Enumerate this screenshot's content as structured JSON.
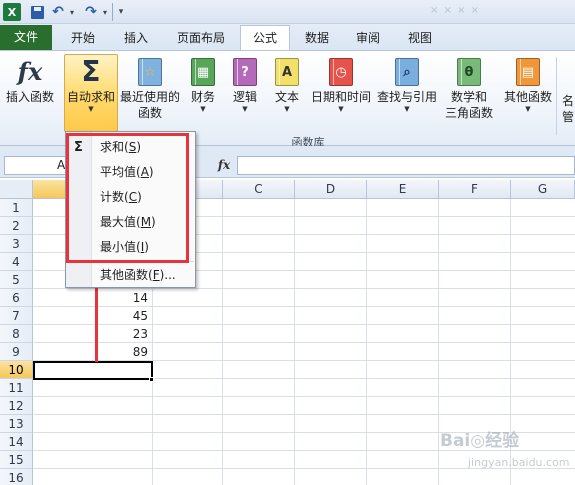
{
  "quick_access": {
    "app_logo": "X",
    "undo_icon": "↶",
    "redo_icon": "↷",
    "dropdown_glyph": "▾",
    "customize_glyph": "▾",
    "title_faint": "× × × ×"
  },
  "tabs": [
    "文件",
    "开始",
    "插入",
    "页面布局",
    "公式",
    "数据",
    "审阅",
    "视图"
  ],
  "active_tab": "公式",
  "ribbon": {
    "insert_function": "插入函数",
    "insert_function_icon": "fx",
    "autosum": "自动求和",
    "autosum_icon": "Σ",
    "recent_line1": "最近使用的",
    "recent_line2": "函数",
    "finance": "财务",
    "logic": "逻辑",
    "text": "文本",
    "datetime": "日期和时间",
    "lookup": "查找与引用",
    "math_line1": "数学和",
    "math_line2": "三角函数",
    "more": "其他函数",
    "next_label": "名管",
    "group_label": "函数库",
    "dropdown_arrow": "▼",
    "icons": {
      "recent": "☆",
      "finance": "▦",
      "logic": "?",
      "text": "A",
      "datetime": "◷",
      "lookup": "⌕",
      "math": "θ",
      "more": "▤"
    }
  },
  "formula_bar": {
    "name_box": "A",
    "fx": "fx",
    "content": ""
  },
  "grid": {
    "columns": [
      "C",
      "D",
      "E",
      "F",
      "G"
    ],
    "rows": [
      "1",
      "2",
      "3",
      "4",
      "5",
      "6",
      "7",
      "8",
      "9",
      "10",
      "11",
      "12",
      "13",
      "14",
      "15",
      "16"
    ],
    "selected_row": "10",
    "values": {
      "r6": "14",
      "r7": "45",
      "r8": "23",
      "r9": "89"
    }
  },
  "dropdown_menu": {
    "sum_icon": "Σ",
    "items": [
      {
        "label": "求和(",
        "key": "S",
        "tail": ")"
      },
      {
        "label": "平均值(",
        "key": "A",
        "tail": ")"
      },
      {
        "label": "计数(",
        "key": "C",
        "tail": ")"
      },
      {
        "label": "最大值(",
        "key": "M",
        "tail": ")"
      },
      {
        "label": "最小值(",
        "key": "I",
        "tail": ")"
      },
      {
        "label": "其他函数(",
        "key": "F",
        "tail": ")..."
      }
    ]
  },
  "watermark": {
    "line1": "Bai◎经验",
    "line2": "jingyan.baidu.com"
  },
  "colors": {
    "file_tab": "#2a6e2f",
    "annotation": "#e8333d",
    "autosum_highlight": "#ffd96b"
  }
}
